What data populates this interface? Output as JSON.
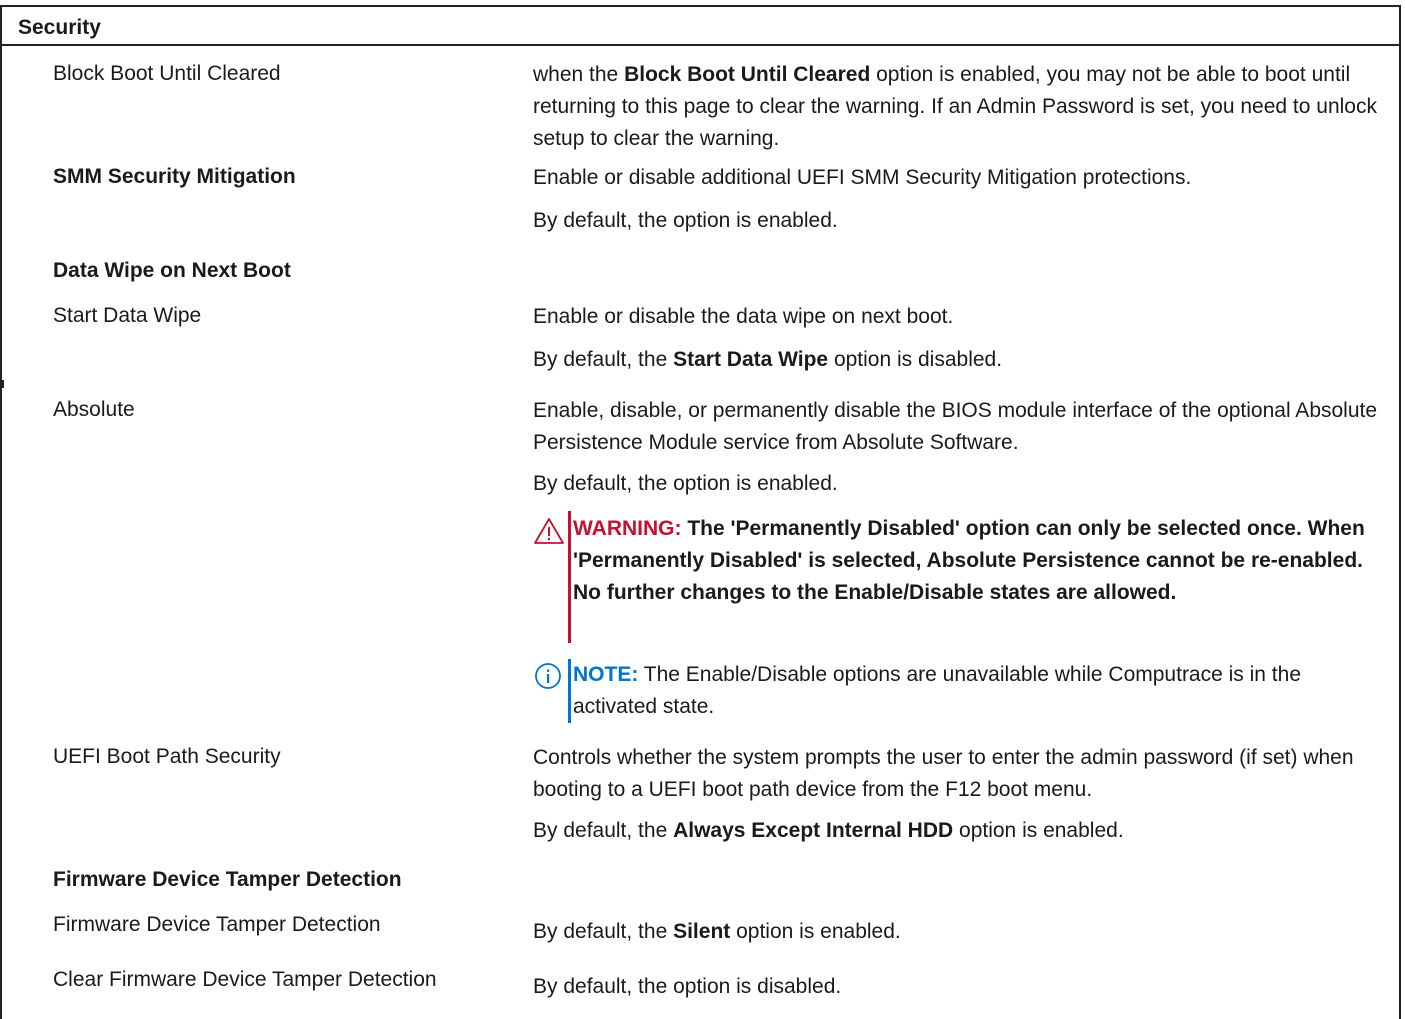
{
  "section": {
    "title": "Security"
  },
  "rows": {
    "block_boot": {
      "label": "Block Boot Until Cleared",
      "desc_pre": "when the ",
      "desc_bold": "Block Boot Until Cleared",
      "desc_post": " option is enabled, you may not be able to boot until returning to this page to clear the warning. If an Admin Password is set, you need to unlock setup to clear the warning."
    },
    "smm": {
      "label": "SMM Security Mitigation",
      "desc": "Enable or disable additional UEFI SMM Security Mitigation protections.",
      "default": "By default, the option is enabled."
    },
    "data_wipe_heading": {
      "label": "Data Wipe on Next Boot"
    },
    "start_data_wipe": {
      "label": "Start Data Wipe",
      "desc": "Enable or disable the data wipe on next boot.",
      "default_pre": "By default, the ",
      "default_bold": "Start Data Wipe",
      "default_post": " option is disabled."
    },
    "absolute": {
      "label": "Absolute",
      "desc": "Enable, disable, or permanently disable the BIOS module interface of the optional Absolute Persistence Module service from Absolute Software.",
      "default": "By default, the option is enabled.",
      "warning_label": "WARNING:",
      "warning_text": " The 'Permanently Disabled' option can only be selected once. When 'Permanently Disabled' is selected, Absolute Persistence cannot be re-enabled. No further changes to the Enable/Disable states are allowed.",
      "note_label": "NOTE:",
      "note_text": " The Enable/Disable options are unavailable while Computrace is in the activated state."
    },
    "uefi_boot_path": {
      "label": "UEFI Boot Path Security",
      "desc": "Controls whether the system prompts the user to enter the admin password (if set) when booting to a UEFI boot path device from the F12 boot menu.",
      "default_pre": "By default, the ",
      "default_bold": "Always Except Internal HDD",
      "default_post": " option is enabled."
    },
    "fw_tamper_heading": {
      "label": "Firmware Device Tamper Detection"
    },
    "fw_tamper": {
      "label": "Firmware Device Tamper Detection",
      "default_pre": "By default, the ",
      "default_bold": "Silent",
      "default_post": " option is enabled."
    },
    "clear_fw_tamper": {
      "label": "Clear Firmware Device Tamper Detection",
      "default": "By default, the option is disabled."
    }
  },
  "colors": {
    "warning": "#c8102e",
    "note": "#0076ce",
    "border": "#222222",
    "text": "#1a1a1a"
  },
  "icons": {
    "warning": "warning-triangle-icon",
    "note": "info-circle-icon"
  }
}
